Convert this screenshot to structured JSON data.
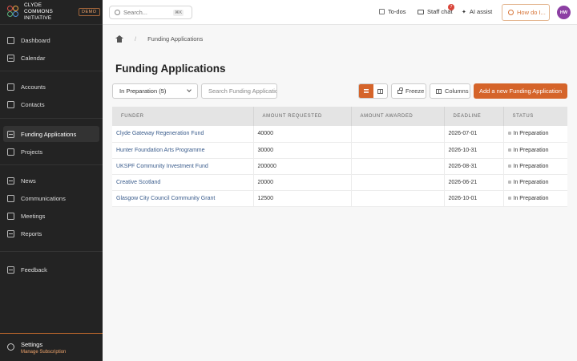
{
  "app": {
    "name": "Clyde Commons Initiative",
    "badge": "DEMO"
  },
  "sidebar": {
    "items": [
      {
        "label": "Dashboard"
      },
      {
        "label": "Calendar"
      },
      {
        "label": "Accounts"
      },
      {
        "label": "Contacts"
      },
      {
        "label": "Funding Applications"
      },
      {
        "label": "Projects"
      },
      {
        "label": "News"
      },
      {
        "label": "Communications"
      },
      {
        "label": "Meetings"
      },
      {
        "label": "Reports"
      },
      {
        "label": "Feedback"
      }
    ],
    "settings_label": "Settings",
    "settings_sub": "Manage Subscription"
  },
  "topbar": {
    "search_placeholder": "Search...",
    "search_shortcut": "⌘K",
    "todos": "To-dos",
    "staff_chat": "Staff chat",
    "chat_badge": "7",
    "ai_assist": "AI assist",
    "how_do_i": "How do I...",
    "avatar_initials": "HW"
  },
  "breadcrumb": {
    "separator": "/",
    "current": "Funding Applications"
  },
  "page": {
    "title": "Funding Applications"
  },
  "toolbar": {
    "filter_value": "In Preparation (5)",
    "search_placeholder": "Search Funding Applications",
    "freeze": "Freeze",
    "columns": "Columns",
    "add": "Add a new Funding Application"
  },
  "table": {
    "headers": [
      "Funder",
      "Amount Requested",
      "Amount Awarded",
      "Deadline",
      "Status"
    ],
    "rows": [
      {
        "funder": "Clyde Gateway Regeneration Fund",
        "requested": "40000",
        "awarded": "",
        "deadline": "2026-07-01",
        "status": "In Preparation"
      },
      {
        "funder": "Hunter Foundation Arts Programme",
        "requested": "30000",
        "awarded": "",
        "deadline": "2026-10-31",
        "status": "In Preparation"
      },
      {
        "funder": "UKSPF Community Investment Fund",
        "requested": "200000",
        "awarded": "",
        "deadline": "2026-08-31",
        "status": "In Preparation"
      },
      {
        "funder": "Creative Scotland",
        "requested": "20000",
        "awarded": "",
        "deadline": "2026-06-21",
        "status": "In Preparation"
      },
      {
        "funder": "Glasgow City Council Community Grant",
        "requested": "12500",
        "awarded": "",
        "deadline": "2026-10-01",
        "status": "In Preparation"
      }
    ]
  },
  "colors": {
    "accent": "#d5642a",
    "sidebar_bg": "#232323",
    "link": "#3a5c8c",
    "avatar": "#8c3fa3"
  }
}
